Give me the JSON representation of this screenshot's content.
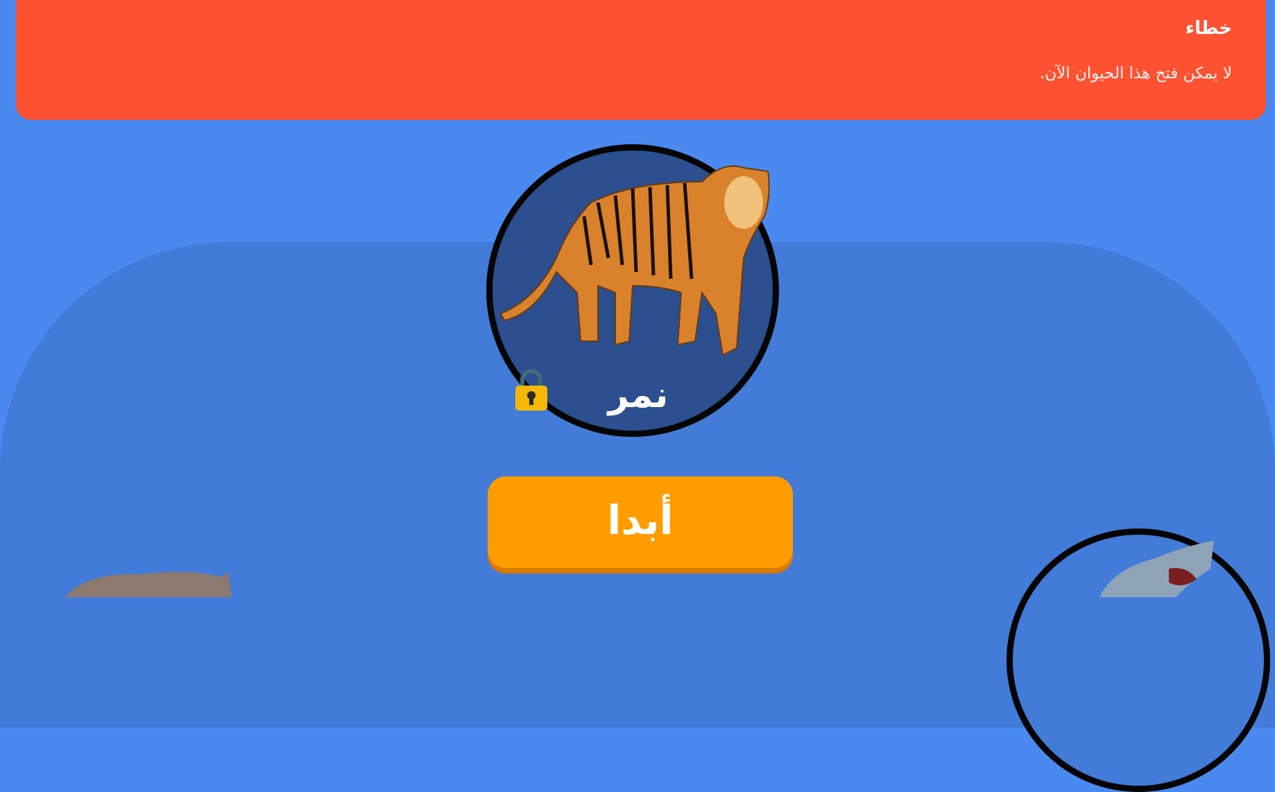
{
  "error_banner": {
    "title": "خطاء",
    "message": "لا يمكن فتح هذا الحيوان الآن.",
    "color": "#ff5233"
  },
  "featured_animal": {
    "name": "نمر",
    "image": "tiger",
    "locked": true,
    "lock_icon": "padlock-icon"
  },
  "start_button": {
    "label": "أبدا",
    "color": "#ff9c00"
  },
  "other_animals": [
    {
      "image": "hippo"
    },
    {
      "image": "shark"
    }
  ],
  "colors": {
    "background": "#4a8af0",
    "panel": "#427bd8",
    "card": "#2b4f8f"
  }
}
